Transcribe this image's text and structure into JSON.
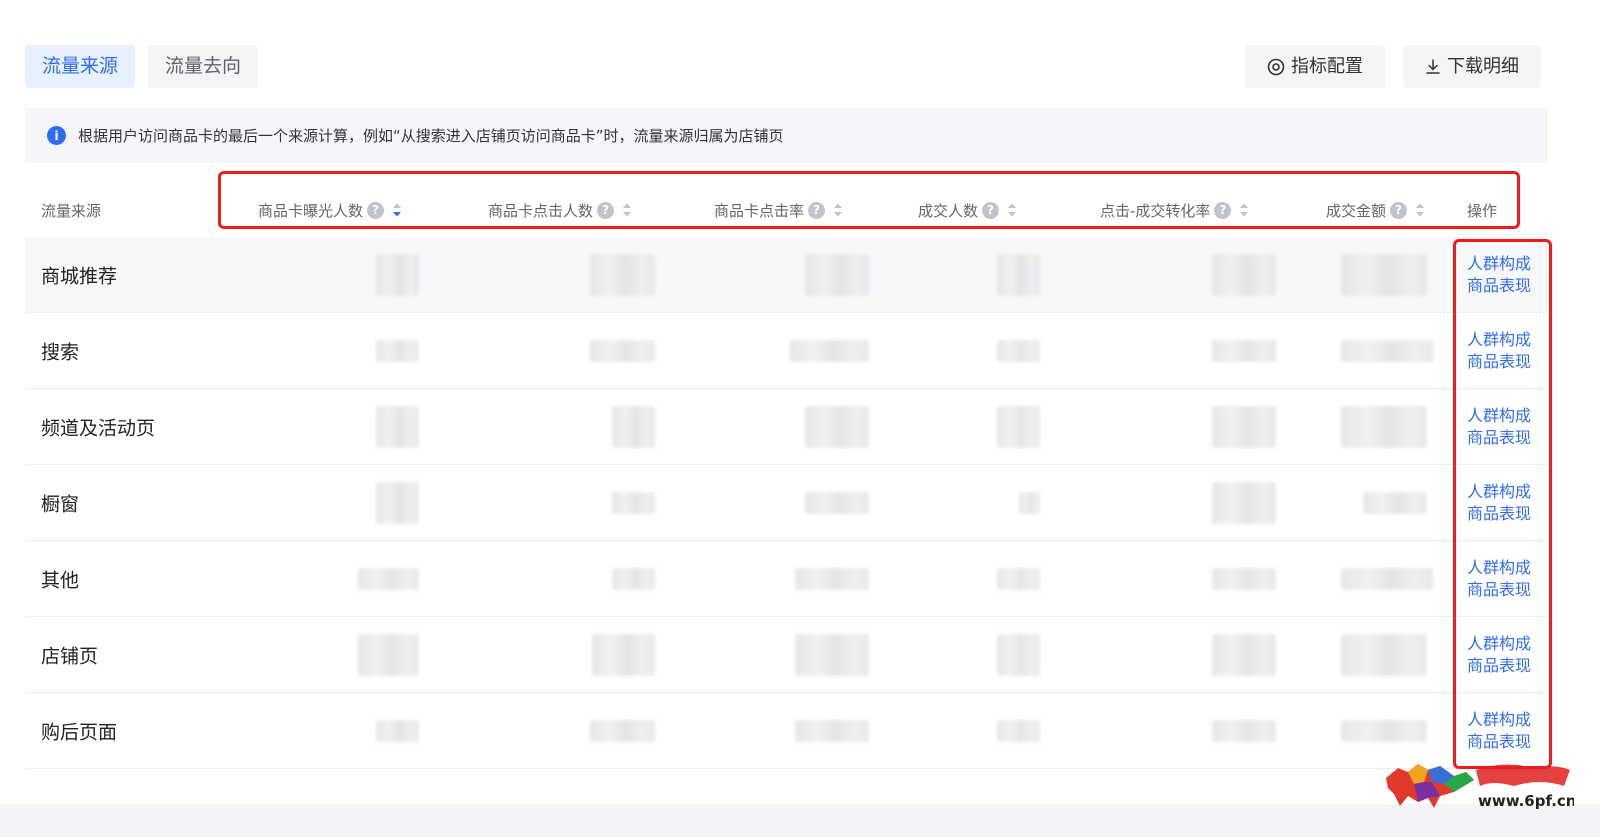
{
  "tabs": [
    {
      "label": "流量来源",
      "active": true
    },
    {
      "label": "流量去向",
      "active": false
    }
  ],
  "toolbar": {
    "metrics_label": "指标配置",
    "download_label": "下载明细"
  },
  "notice": {
    "text": "根据用户访问商品卡的最后一个来源计算，例如“从搜索进入店铺页访问商品卡”时，流量来源归属为店铺页"
  },
  "table": {
    "columns": [
      "流量来源",
      "商品卡曝光人数",
      "商品卡点击人数",
      "商品卡点击率",
      "成交人数",
      "点击-成交转化率",
      "成交金额",
      "操作"
    ],
    "rows": [
      {
        "source": "商城推荐"
      },
      {
        "source": "搜索"
      },
      {
        "source": "频道及活动页"
      },
      {
        "source": "橱窗"
      },
      {
        "source": "其他"
      },
      {
        "source": "店铺页"
      },
      {
        "source": "购后页面"
      }
    ],
    "actions": [
      "人群构成",
      "商品表现"
    ]
  },
  "watermark": {
    "url_text": "www.6pf.cn"
  },
  "colors": {
    "accent": "#2f6dec",
    "highlight": "#ee1c1c",
    "tab_active_bg": "#eaf1fe"
  }
}
